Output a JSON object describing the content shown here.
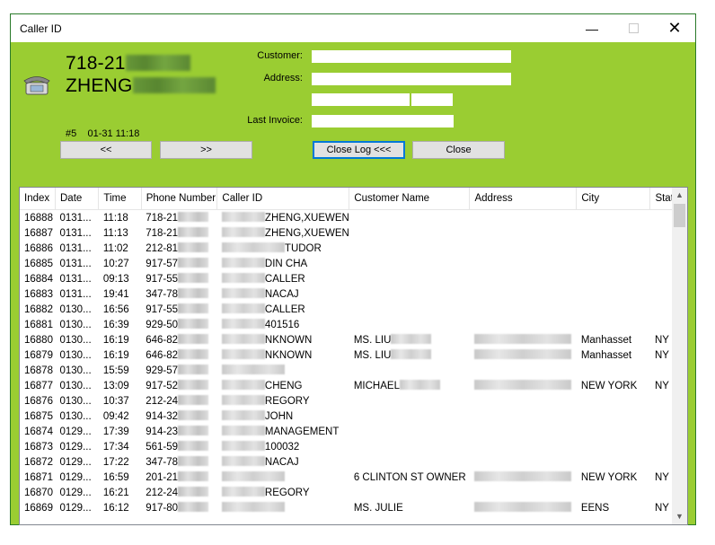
{
  "window": {
    "title": "Caller ID"
  },
  "caller": {
    "phone_prefix": "718-21",
    "name_prefix": "ZHENG",
    "line_info": "#5    01-31 11:18"
  },
  "form": {
    "customer_label": "Customer:",
    "address_label": "Address:",
    "last_invoice_label": "Last Invoice:",
    "customer_value": "",
    "address_value": "",
    "address2_value": "",
    "zip_value": "",
    "last_invoice_value": ""
  },
  "buttons": {
    "prev": "<<",
    "next": ">>",
    "close_log": "Close Log <<<",
    "close": "Close"
  },
  "log": {
    "columns": [
      "Index",
      "Date",
      "Time",
      "Phone Number",
      "Caller ID",
      "Customer Name",
      "Address",
      "City",
      "State"
    ],
    "rows": [
      {
        "index": "16888",
        "date": "0131...",
        "time": "11:18",
        "phone": "718-21",
        "caller": "ZHENG,XUEWEN",
        "caller_mask": "left",
        "customer": "",
        "address": "",
        "city": "",
        "state": ""
      },
      {
        "index": "16887",
        "date": "0131...",
        "time": "11:13",
        "phone": "718-21",
        "caller": "ZHENG,XUEWEN",
        "caller_mask": "left",
        "customer": "",
        "address": "",
        "city": "",
        "state": ""
      },
      {
        "index": "16886",
        "date": "0131...",
        "time": "11:02",
        "phone": "212-81",
        "caller": "TUDOR",
        "caller_mask": "all",
        "customer": "",
        "address": "",
        "city": "",
        "state": ""
      },
      {
        "index": "16885",
        "date": "0131...",
        "time": "10:27",
        "phone": "917-57",
        "caller": "DIN CHA",
        "caller_mask": "left",
        "customer": "",
        "address": "",
        "city": "",
        "state": ""
      },
      {
        "index": "16884",
        "date": "0131...",
        "time": "09:13",
        "phone": "917-55",
        "caller": "CALLER",
        "caller_mask": "left",
        "customer": "",
        "address": "",
        "city": "",
        "state": ""
      },
      {
        "index": "16883",
        "date": "0131...",
        "time": "19:41",
        "phone": "347-78",
        "caller": "NACAJ",
        "caller_mask": "left",
        "customer": "",
        "address": "",
        "city": "",
        "state": ""
      },
      {
        "index": "16882",
        "date": "0130...",
        "time": "16:56",
        "phone": "917-55",
        "caller": "CALLER",
        "caller_mask": "left",
        "customer": "",
        "address": "",
        "city": "",
        "state": ""
      },
      {
        "index": "16881",
        "date": "0130...",
        "time": "16:39",
        "phone": "929-50",
        "caller": "401516",
        "caller_mask": "left",
        "customer": "",
        "address": "",
        "city": "",
        "state": ""
      },
      {
        "index": "16880",
        "date": "0130...",
        "time": "16:19",
        "phone": "646-82",
        "caller": "NKNOWN",
        "caller_mask": "left",
        "customer": "MS. LIU",
        "customer_mask": true,
        "address": "",
        "address_mask": true,
        "city": "Manhasset",
        "state": "NY"
      },
      {
        "index": "16879",
        "date": "0130...",
        "time": "16:19",
        "phone": "646-82",
        "caller": "NKNOWN",
        "caller_mask": "left",
        "customer": "MS. LIU",
        "customer_mask": true,
        "address": "",
        "address_mask": true,
        "city": "Manhasset",
        "state": "NY"
      },
      {
        "index": "16878",
        "date": "0130...",
        "time": "15:59",
        "phone": "929-57",
        "caller": "",
        "caller_mask": "all",
        "customer": "",
        "address": "",
        "city": "",
        "state": ""
      },
      {
        "index": "16877",
        "date": "0130...",
        "time": "13:09",
        "phone": "917-52",
        "caller": "CHENG",
        "caller_mask": "left",
        "customer": "MICHAEL",
        "customer_mask": true,
        "address": "",
        "address_mask": true,
        "city": "NEW YORK",
        "state": "NY"
      },
      {
        "index": "16876",
        "date": "0130...",
        "time": "10:37",
        "phone": "212-24",
        "caller": "REGORY",
        "caller_mask": "left",
        "customer": "",
        "address": "",
        "city": "",
        "state": ""
      },
      {
        "index": "16875",
        "date": "0130...",
        "time": "09:42",
        "phone": "914-32",
        "caller": "JOHN",
        "caller_mask": "left",
        "customer": "",
        "address": "",
        "city": "",
        "state": ""
      },
      {
        "index": "16874",
        "date": "0129...",
        "time": "17:39",
        "phone": "914-23",
        "caller": "MANAGEMENT",
        "caller_mask": "left",
        "customer": "",
        "address": "",
        "city": "",
        "state": ""
      },
      {
        "index": "16873",
        "date": "0129...",
        "time": "17:34",
        "phone": "561-59",
        "caller": "100032",
        "caller_mask": "left",
        "customer": "",
        "address": "",
        "city": "",
        "state": ""
      },
      {
        "index": "16872",
        "date": "0129...",
        "time": "17:22",
        "phone": "347-78",
        "caller": "NACAJ",
        "caller_mask": "left",
        "customer": "",
        "address": "",
        "city": "",
        "state": ""
      },
      {
        "index": "16871",
        "date": "0129...",
        "time": "16:59",
        "phone": "201-21",
        "caller": "",
        "caller_mask": "all",
        "customer": "6 CLINTON ST OWNER",
        "customer_mask": false,
        "address": "",
        "address_mask": true,
        "city": "NEW YORK",
        "state": "NY"
      },
      {
        "index": "16870",
        "date": "0129...",
        "time": "16:21",
        "phone": "212-24",
        "caller": "REGORY",
        "caller_mask": "left",
        "customer": "",
        "address": "",
        "city": "",
        "state": ""
      },
      {
        "index": "16869",
        "date": "0129...",
        "time": "16:12",
        "phone": "917-80",
        "caller": "",
        "caller_mask": "all",
        "customer": "MS. JULIE",
        "customer_mask": false,
        "address": "",
        "address_mask": true,
        "city": "EENS",
        "state": "NY"
      }
    ]
  }
}
